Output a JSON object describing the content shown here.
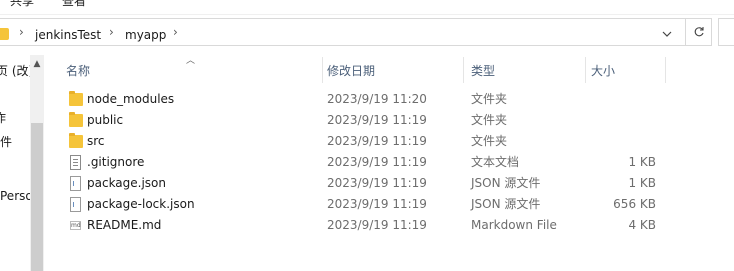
{
  "ribbon": {
    "tabs": [
      "共享",
      "查看"
    ]
  },
  "address": {
    "breadcrumbs": [
      "jenkinsTest",
      "myapp"
    ],
    "dropdown_icon": "chevron-down-icon",
    "refresh_icon": "refresh-icon"
  },
  "nav": {
    "items": [
      "页 (改)",
      "作",
      "文件",
      "Perso"
    ]
  },
  "columns": {
    "name": "名称",
    "date": "修改日期",
    "type": "类型",
    "size": "大小"
  },
  "files": [
    {
      "name": "node_modules",
      "date": "2023/9/19 11:20",
      "type": "文件夹",
      "size": "",
      "icon": "folder-icon"
    },
    {
      "name": "public",
      "date": "2023/9/19 11:19",
      "type": "文件夹",
      "size": "",
      "icon": "folder-icon"
    },
    {
      "name": "src",
      "date": "2023/9/19 11:19",
      "type": "文件夹",
      "size": "",
      "icon": "folder-icon"
    },
    {
      "name": ".gitignore",
      "date": "2023/9/19 11:19",
      "type": "文本文档",
      "size": "1 KB",
      "icon": "text-file-icon"
    },
    {
      "name": "package.json",
      "date": "2023/9/19 11:19",
      "type": "JSON 源文件",
      "size": "1 KB",
      "icon": "json-file-icon"
    },
    {
      "name": "package-lock.json",
      "date": "2023/9/19 11:19",
      "type": "JSON 源文件",
      "size": "656 KB",
      "icon": "json-file-icon"
    },
    {
      "name": "README.md",
      "date": "2023/9/19 11:19",
      "type": "Markdown File",
      "size": "4 KB",
      "icon": "markdown-file-icon"
    }
  ],
  "colors": {
    "folder": "#f5c43a",
    "header_text": "#4c607a",
    "meta_text": "#6d6d6d"
  }
}
